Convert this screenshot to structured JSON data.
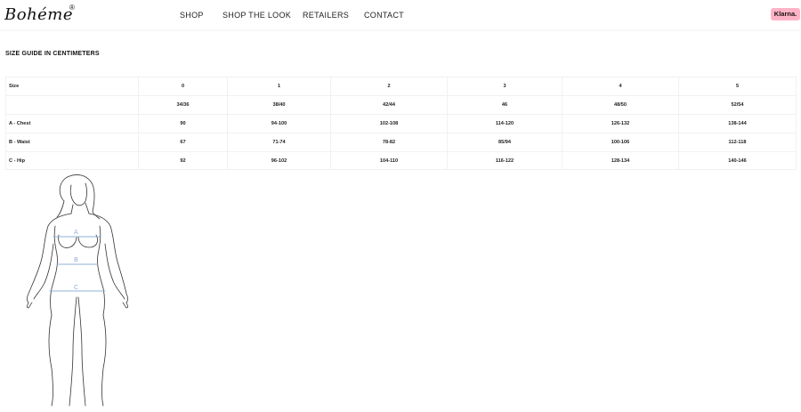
{
  "brand": {
    "name": "Bohéme",
    "registered_mark": "®"
  },
  "nav": {
    "items": [
      "SHOP",
      "SHOP THE LOOK",
      "RETAILERS",
      "CONTACT"
    ]
  },
  "klarna": {
    "label": "Klarna."
  },
  "size_guide": {
    "title": "SIZE GUIDE IN CENTIMETERS",
    "rows": [
      [
        "Size",
        "0",
        "1",
        "2",
        "3",
        "4",
        "5"
      ],
      [
        "",
        "34/36",
        "38/40",
        "42/44",
        "46",
        "48/50",
        "52/54"
      ],
      [
        "A - Chest",
        "90",
        "94-100",
        "102-108",
        "114-120",
        "126-132",
        "138-144"
      ],
      [
        "B - Waist",
        "67",
        "71-74",
        "78-82",
        "85/94",
        "100-106",
        "112-118"
      ],
      [
        "C - Hip",
        "92",
        "96-102",
        "104-110",
        "116-122",
        "128-134",
        "140-146"
      ]
    ]
  },
  "figure": {
    "labels": [
      "A",
      "B",
      "C"
    ],
    "line_color": "#8fb0d8",
    "outline_color": "#333333"
  },
  "colors": {
    "klarna_pink": "#ffb3c7"
  }
}
